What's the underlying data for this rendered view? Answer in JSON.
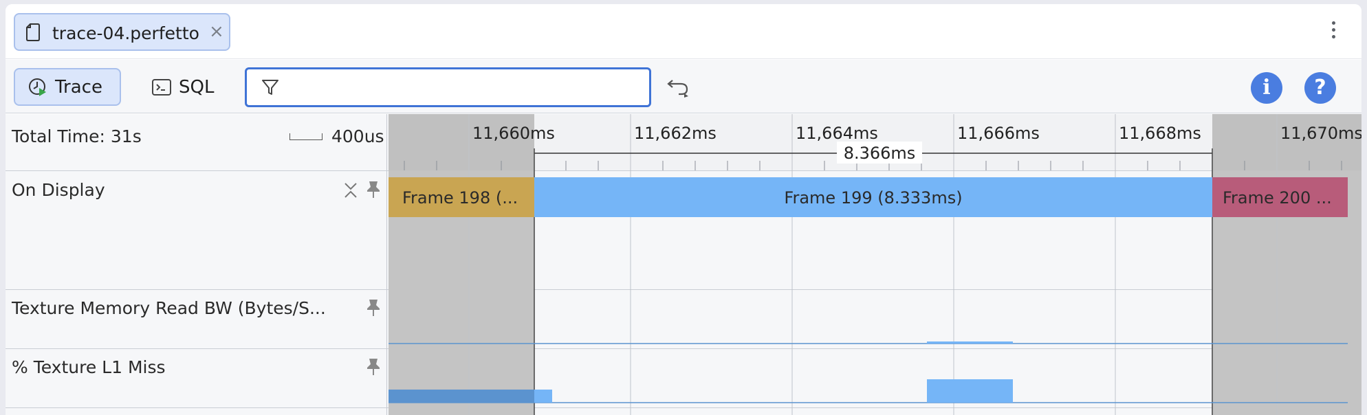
{
  "tab": {
    "title": "trace-04.perfetto",
    "close": "×"
  },
  "toolbar": {
    "trace_label": "Trace",
    "sql_label": "SQL",
    "filter_placeholder": "",
    "info_label": "i",
    "help_label": "?"
  },
  "timeline": {
    "total_time": "Total Time: 31s",
    "scale_label": "400us",
    "ticks": [
      "11,660ms",
      "11,662ms",
      "11,664ms",
      "11,666ms",
      "11,668ms",
      "11,670ms"
    ],
    "selection_duration": "8.366ms"
  },
  "tracks": [
    {
      "name": "On Display"
    },
    {
      "name": "Texture Memory Read BW (Bytes/S..."
    },
    {
      "name": "% Texture L1 Miss"
    }
  ],
  "frames": [
    {
      "label": "Frame 198 (...",
      "color": "#c9a552"
    },
    {
      "label": "Frame 199 (8.333ms)",
      "color": "#75b5f7"
    },
    {
      "label": "Frame 200 ...",
      "color": "#b85c7a"
    }
  ],
  "colors": {
    "accent": "#3f73d6",
    "selection_shade": "#c4c4c4",
    "counter": "#75b5f7",
    "counter_dark": "#5b93cf"
  }
}
